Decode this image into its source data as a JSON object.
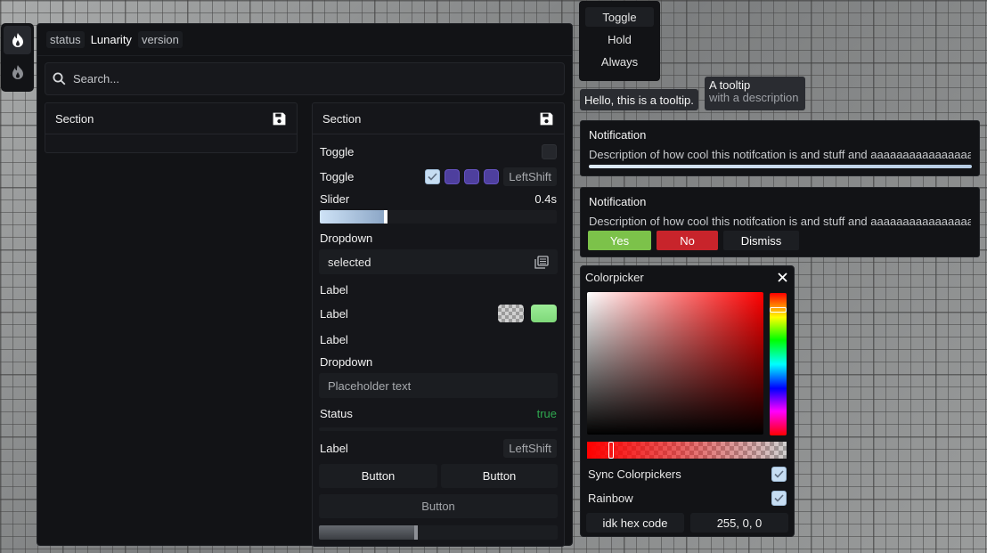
{
  "dock": {
    "items": [
      "flame-icon",
      "flame-icon"
    ]
  },
  "window": {
    "tabs": [
      "status",
      "Lunarity",
      "version"
    ],
    "search": {
      "placeholder": "Search..."
    },
    "left_section": {
      "title": "Section"
    },
    "right_section": {
      "title": "Section",
      "toggle1": {
        "label": "Toggle",
        "checked": false
      },
      "toggle2": {
        "label": "Toggle",
        "checked": true,
        "keybind": "LeftShift"
      },
      "slider": {
        "label": "Slider",
        "value_text": "0.4s",
        "fraction": 0.28
      },
      "dropdown1": {
        "label": "Dropdown",
        "value": "selected"
      },
      "label1": "Label",
      "label2": "Label",
      "label3": "Label",
      "dropdown2": {
        "label": "Dropdown",
        "placeholder": "Placeholder text"
      },
      "status": {
        "label": "Status",
        "value": "true",
        "color": "#2fa84f"
      },
      "label4": {
        "label": "Label",
        "keybind": "LeftShift"
      },
      "button1": "Button",
      "button2": "Button",
      "button3": "Button"
    }
  },
  "mode_menu": {
    "items": [
      "Toggle",
      "Hold",
      "Always"
    ],
    "active": "Toggle"
  },
  "tooltips": {
    "simple": "Hello, this is a tooltip.",
    "titled": {
      "title": "A tooltip",
      "description": "with a description"
    }
  },
  "notification1": {
    "title": "Notification",
    "description": "Description of how cool this notifcation is and stuff and aaaaaaaaaaaaaaaaa",
    "progress": 1.0
  },
  "notification2": {
    "title": "Notification",
    "description": "Description of how cool this notifcation is and stuff and aaaaaaaaaaaaaaaaa",
    "yes": "Yes",
    "no": "No",
    "dismiss": "Dismiss",
    "yes_color": "#7cc24a",
    "no_color": "#c8242b"
  },
  "colorpicker": {
    "title": "Colorpicker",
    "hue_color": "#ff0000",
    "sync_label": "Sync Colorpickers",
    "rainbow_label": "Rainbow",
    "hex_label": "idk hex code",
    "rgb_value": "255, 0, 0"
  },
  "colors": {
    "accent": "#5b4bb8",
    "background": "#121316",
    "green": "#8ee28c"
  }
}
